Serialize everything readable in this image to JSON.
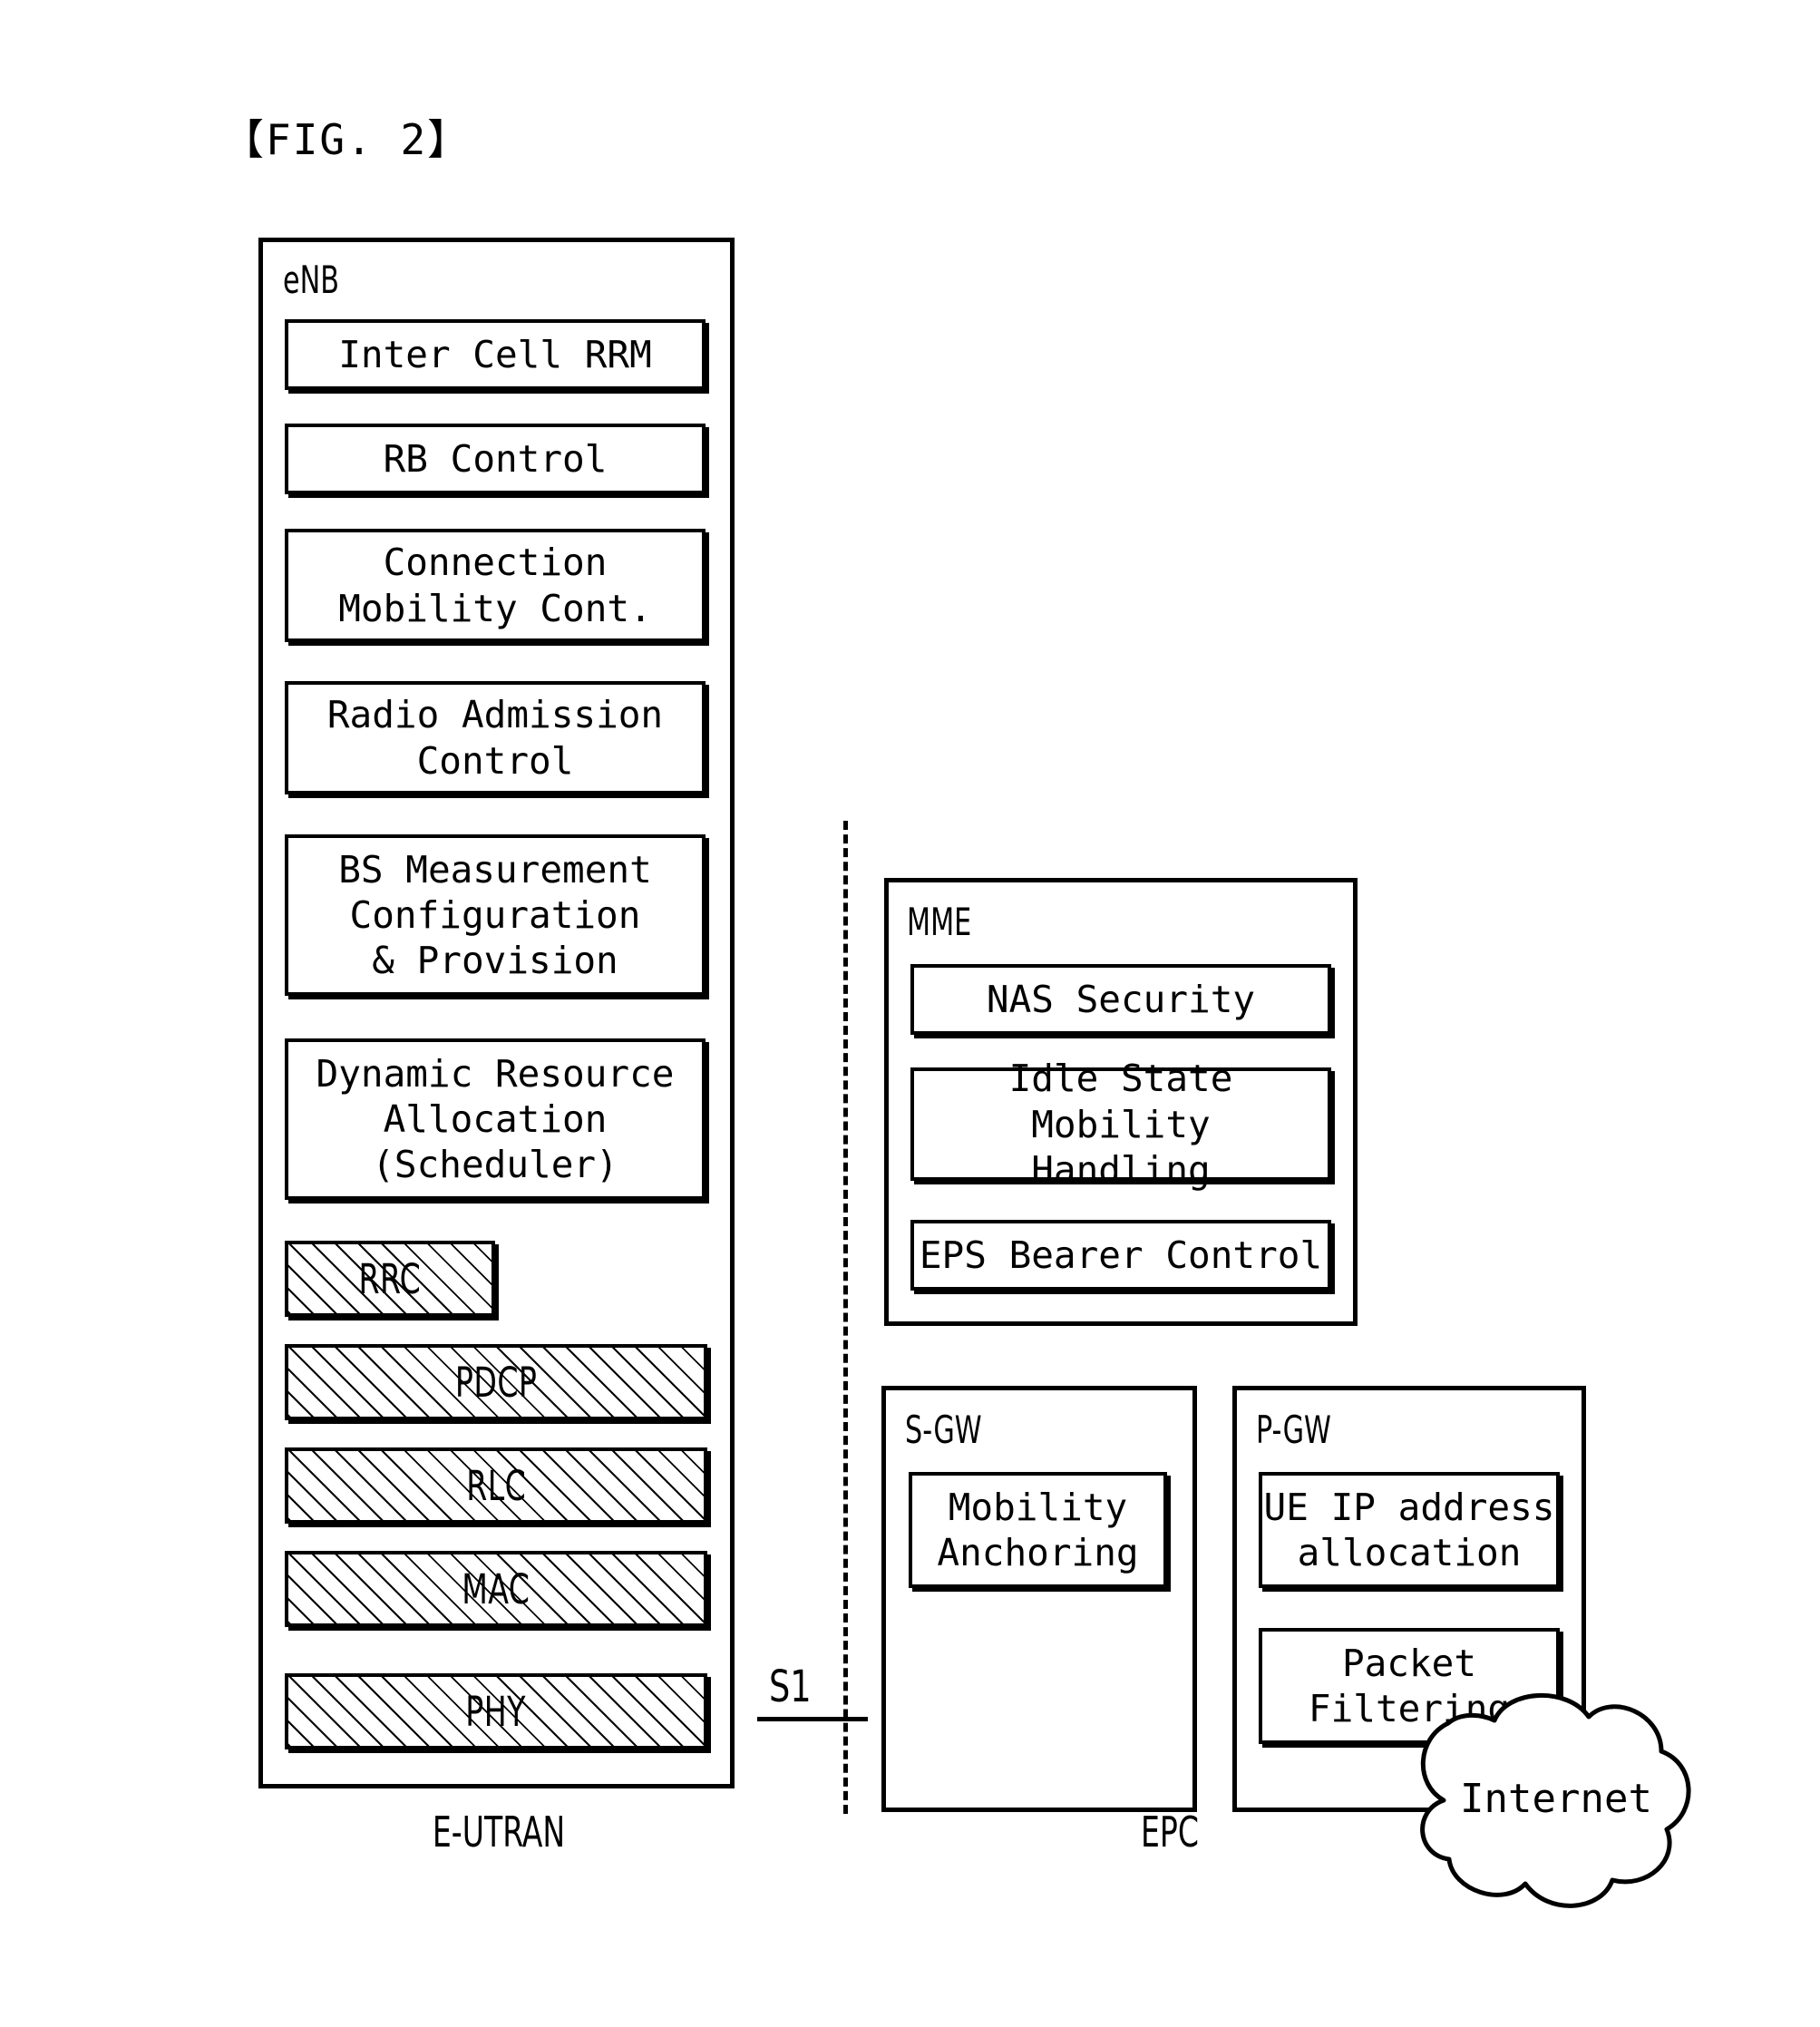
{
  "figure": {
    "title": "【FIG. 2】"
  },
  "enb": {
    "label": "eNB",
    "functions": [
      {
        "text": "Inter Cell RRM"
      },
      {
        "text": "RB Control"
      },
      {
        "text": "Connection\nMobility Cont."
      },
      {
        "text": "Radio Admission\nControl"
      },
      {
        "text": "BS Measurement\nConfiguration\n& Provision"
      },
      {
        "text": "Dynamic Resource\nAllocation\n(Scheduler)"
      }
    ],
    "stack": [
      {
        "text": "RRC"
      },
      {
        "text": "PDCP"
      },
      {
        "text": "RLC"
      },
      {
        "text": "MAC"
      },
      {
        "text": "PHY"
      }
    ]
  },
  "mme": {
    "label": "MME",
    "functions": [
      {
        "text": "NAS Security"
      },
      {
        "text": "Idle State Mobility\nHandling"
      },
      {
        "text": "EPS Bearer Control"
      }
    ]
  },
  "sgw": {
    "label": "S-GW",
    "functions": [
      {
        "text": "Mobility\nAnchoring"
      }
    ]
  },
  "pgw": {
    "label": "P-GW",
    "functions": [
      {
        "text": "UE IP address\nallocation"
      },
      {
        "text": "Packet\nFiltering"
      }
    ]
  },
  "interface": {
    "s1_label": "S1"
  },
  "captions": {
    "left": "E-UTRAN",
    "right": "EPC"
  },
  "cloud": {
    "label": "Internet"
  },
  "colors": {
    "ink": "#000000",
    "paper": "#ffffff"
  }
}
